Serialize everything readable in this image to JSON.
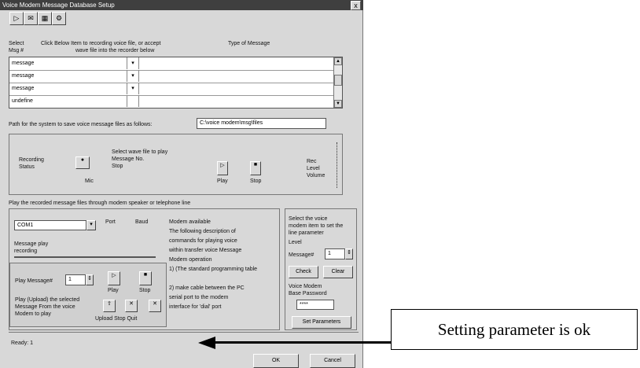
{
  "window": {
    "title": "Voice Modem Message Database Setup",
    "close_label": "x"
  },
  "toolbar": {
    "icons": [
      "new-icon",
      "open-icon",
      "save-icon",
      "settings-icon"
    ],
    "glyphs": [
      "▷",
      "✉",
      "▦",
      "⚙"
    ]
  },
  "header": {
    "select_label": "Select",
    "msg_label": "Msg #",
    "hint_line1": "Click Below Item to recording voice file, or accept",
    "hint_line2": "wave file into the recorder below",
    "type_label": "Type of Message"
  },
  "list": {
    "rows": [
      {
        "name": "message",
        "dd": "▾"
      },
      {
        "name": "message",
        "dd": "▾"
      },
      {
        "name": "message",
        "dd": "▾"
      },
      {
        "name": "undefine",
        "dd": ""
      }
    ]
  },
  "path_row": {
    "label": "Path for the system to save voice message files as follows:",
    "value": "C:\\voice modem\\msg\\files"
  },
  "recorder_panel": {
    "left_label_1": "Recording",
    "left_label_2": "Status",
    "mic_caption": "Mic",
    "info_line1": "Select wave file to play",
    "info_line2": "Message No.",
    "info_line3": "Stop",
    "play_caption": "Play",
    "stop_caption": "Stop",
    "volume_label_1": "Rec",
    "volume_label_2": "Level",
    "volume_label_3": "Volume"
  },
  "section_label": "Play the recorded message files through modem speaker or telephone line",
  "lower_panel": {
    "port_value": "COM1",
    "port_label": "Port",
    "baud_label": "Baud",
    "status_label": "Modem available",
    "progress_label": "Message play",
    "progress_state": "recording",
    "info_lines": [
      "The following description of",
      "commands for playing voice",
      "within transfer voice Message",
      "Modem operation",
      "1) (The standard programming table",
      "2) make cable between the PC",
      "serial port to the modem",
      "interface for 'dial' port"
    ],
    "play_msg_label": "Play Message#",
    "play_msg_value": "1",
    "play_caption": "Play",
    "stop_caption": "Stop",
    "upload_note_1": "Play (Upload) the selected",
    "upload_note_2": "Message From the voice",
    "upload_note_3": "Modem to play",
    "upload_caption": "Upload  Stop  Quit"
  },
  "right_panel": {
    "text_lines": [
      "Select the voice",
      "modem item to set the",
      "line parameter",
      "Level"
    ],
    "msg_label": "Message#",
    "msg_value": "1",
    "check_label": "Check",
    "clear_label": "Clear",
    "pw_label_1": "Voice Modem",
    "pw_label_2": "Base Password",
    "pw_value": "****",
    "action_label": "Set Parameters"
  },
  "status_bar": {
    "text": "Ready: 1"
  },
  "footer": {
    "ok_label": "OK",
    "cancel_label": "Cancel"
  },
  "annotation": {
    "text": "Setting parameter is ok"
  }
}
